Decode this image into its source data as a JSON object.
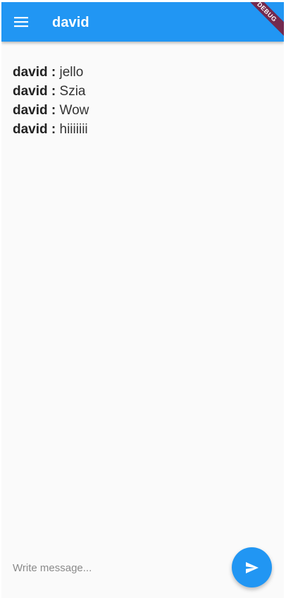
{
  "app_bar": {
    "title": "david",
    "menu_icon": "menu-icon",
    "background_color": "#2196f3"
  },
  "debug_banner": {
    "label": "DEBUG"
  },
  "messages": [
    {
      "sender": "david :",
      "text": "jello"
    },
    {
      "sender": "david :",
      "text": "Szia"
    },
    {
      "sender": "david :",
      "text": "Wow"
    },
    {
      "sender": "david :",
      "text": "hiiiiiii"
    }
  ],
  "composer": {
    "placeholder": "Write message...",
    "value": "",
    "send_icon": "send-icon",
    "send_button_color": "#2196f3"
  }
}
